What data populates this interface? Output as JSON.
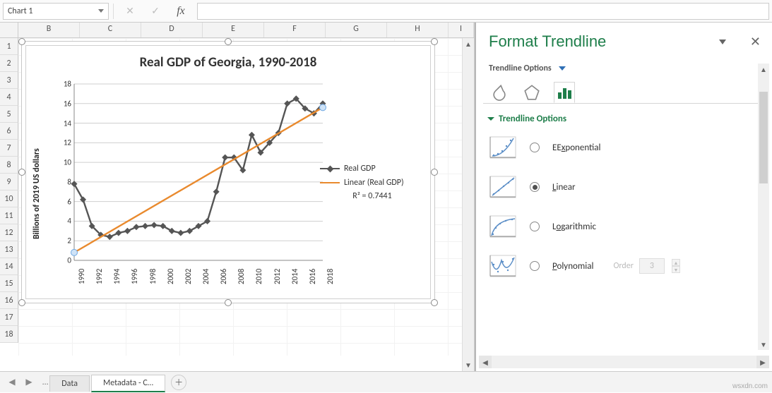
{
  "name_box": {
    "value": "Chart 1"
  },
  "formula_bar": {
    "cancel_glyph": "✕",
    "confirm_glyph": "✓",
    "fx_label": "fx",
    "value": ""
  },
  "columns": [
    "B",
    "C",
    "D",
    "E",
    "F",
    "G",
    "H",
    "I"
  ],
  "rows": [
    "1",
    "2",
    "3",
    "4",
    "5",
    "6",
    "7",
    "8",
    "9",
    "10",
    "11",
    "12",
    "13",
    "14",
    "15",
    "16",
    "17",
    "18"
  ],
  "chart_title": "Real GDP of Georgia, 1990-2018",
  "y_axis_label": "Billions of  2019 US dollars",
  "legend": {
    "series_label": "Real GDP",
    "trend_label": "Linear (Real GDP)",
    "r2_label": "R² = 0.7441"
  },
  "chart_data": {
    "type": "line",
    "title": "Real GDP of Georgia, 1990-2018",
    "xlabel": "",
    "ylabel": "Billions of  2019 US dollars",
    "ylim": [
      0,
      18
    ],
    "yticks": [
      0,
      2,
      4,
      6,
      8,
      10,
      12,
      14,
      16,
      18
    ],
    "xticks": [
      1990,
      1992,
      1994,
      1996,
      1998,
      2000,
      2002,
      2004,
      2006,
      2008,
      2010,
      2012,
      2014,
      2016,
      2018
    ],
    "series": [
      {
        "name": "Real GDP",
        "x": [
          1990,
          1991,
          1992,
          1993,
          1994,
          1995,
          1996,
          1997,
          1998,
          1999,
          2000,
          2001,
          2002,
          2003,
          2004,
          2005,
          2006,
          2007,
          2008,
          2009,
          2010,
          2011,
          2012,
          2013,
          2014,
          2015,
          2016,
          2017,
          2018
        ],
        "values": [
          7.8,
          6.2,
          3.5,
          2.6,
          2.4,
          2.8,
          3.0,
          3.4,
          3.5,
          3.6,
          3.5,
          3.0,
          2.8,
          3.0,
          3.5,
          4.0,
          7.0,
          10.5,
          10.5,
          9.2,
          12.8,
          11.0,
          12.0,
          13.0,
          16.0,
          16.5,
          15.5,
          15.0,
          16.0
        ]
      },
      {
        "name": "Linear (Real GDP)",
        "type": "trendline",
        "x": [
          1990,
          2018
        ],
        "values": [
          0.8,
          15.6
        ],
        "r_squared": 0.7441
      }
    ]
  },
  "task_pane": {
    "title": "Format Trendline",
    "subheading": "Trendline Options",
    "section_heading": "Trendline Options",
    "options": {
      "exponential": "Exponential",
      "linear": "Linear",
      "logarithmic": "Logarithmic",
      "polynomial": "Polynomial",
      "order_label": "Order",
      "order_value": "3"
    },
    "selected": "linear"
  },
  "sheet_tabs": {
    "data": "Data",
    "metadata": "Metadata - C…"
  },
  "watermark": "wsxdn.com"
}
